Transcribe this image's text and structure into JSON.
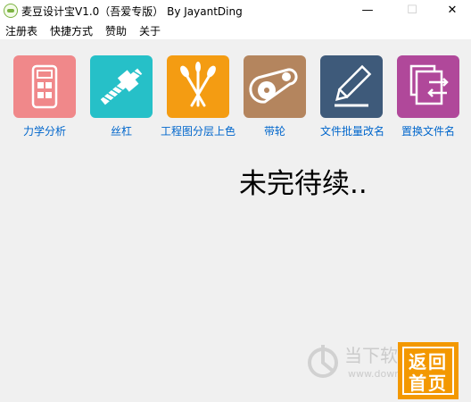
{
  "window": {
    "title": "麦豆设计宝V1.0（吾爱专版） By JayantDing",
    "controls": {
      "minimize": "—",
      "maximize": "☐",
      "close": "✕"
    }
  },
  "menu": [
    "注册表",
    "快捷方式",
    "赞助",
    "关于"
  ],
  "tools": [
    {
      "label": "力学分析",
      "icon": "calculator-icon",
      "color": "#f0888a"
    },
    {
      "label": "丝杠",
      "icon": "lead-screw-icon",
      "color": "#26c0c8"
    },
    {
      "label": "工程图分层上色",
      "icon": "paint-brushes-icon",
      "color": "#f49c12"
    },
    {
      "label": "带轮",
      "icon": "belt-pulley-icon",
      "color": "#b4855e"
    },
    {
      "label": "文件批量改名",
      "icon": "rename-pencil-icon",
      "color": "#3e5a7a"
    },
    {
      "label": "置换文件名",
      "icon": "swap-files-icon",
      "color": "#b0489a"
    }
  ],
  "headline": "未完待续..",
  "back_button": {
    "line1": "返回",
    "line2": "首页"
  },
  "watermark": {
    "text": "当下软件园",
    "url": "www.downxia.com"
  }
}
